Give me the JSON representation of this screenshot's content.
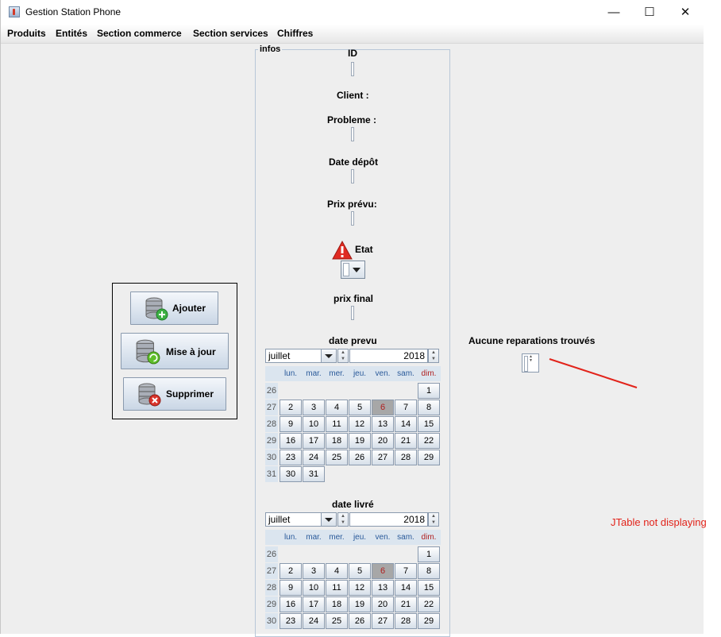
{
  "window": {
    "title": "Gestion Station Phone",
    "controls": {
      "minimize": "—",
      "maximize": "☐",
      "close": "✕"
    }
  },
  "menu": [
    "Produits",
    "Entités",
    "Section commerce",
    "Section services",
    "Chiffres"
  ],
  "form": {
    "group_title": "infos",
    "id_label": "ID",
    "client_label": "Client :",
    "probleme_label": "Probleme :",
    "date_depot_label": "Date dépôt",
    "prix_prevu_label": "Prix prévu:",
    "etat_label": "Etat",
    "prix_final_label": "prix final",
    "date_prevu_label": "date prevu",
    "date_livre_label": "date livré"
  },
  "calendar": {
    "month": "juillet",
    "year": "2018",
    "day_headers": [
      "lun.",
      "mar.",
      "mer.",
      "jeu.",
      "ven.",
      "sam.",
      "dim."
    ],
    "week_numbers": [
      "26",
      "27",
      "28",
      "29",
      "30",
      "31"
    ],
    "weeks": [
      [
        "",
        "",
        "",
        "",
        "",
        "",
        "1"
      ],
      [
        "2",
        "3",
        "4",
        "5",
        "6",
        "7",
        "8"
      ],
      [
        "9",
        "10",
        "11",
        "12",
        "13",
        "14",
        "15"
      ],
      [
        "16",
        "17",
        "18",
        "19",
        "20",
        "21",
        "22"
      ],
      [
        "23",
        "24",
        "25",
        "26",
        "27",
        "28",
        "29"
      ],
      [
        "30",
        "31",
        "",
        "",
        "",
        "",
        ""
      ]
    ],
    "selected_day": "6",
    "header_color": "#2a5a9a",
    "sunday_color": "#b02020"
  },
  "calendar2": {
    "month": "juillet",
    "year": "2018",
    "week_numbers": [
      "26",
      "27",
      "28",
      "29",
      "30"
    ]
  },
  "actions": {
    "add": "Ajouter",
    "update": "Mise à jour",
    "delete": "Supprimer"
  },
  "status": {
    "empty_message": "Aucune reparations trouvés"
  },
  "annotation": {
    "text": "JTable not displaying",
    "color": "#e2231a"
  }
}
